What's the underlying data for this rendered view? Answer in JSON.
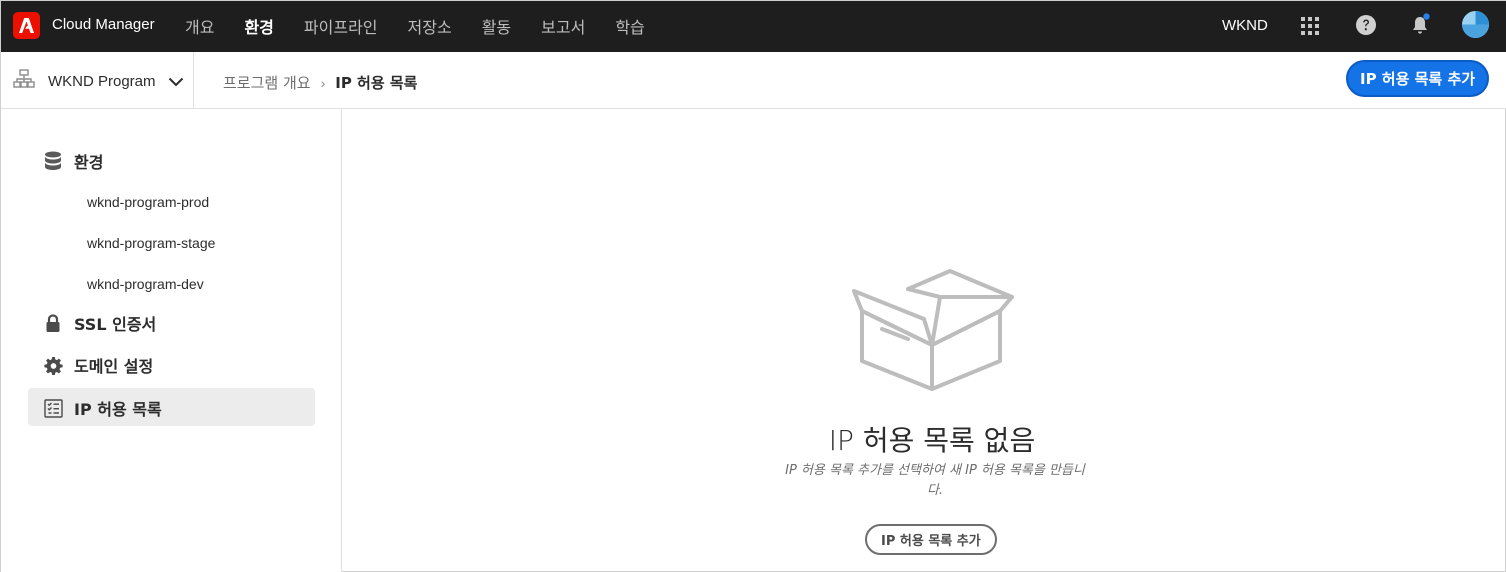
{
  "app": {
    "title": "Cloud Manager",
    "brand_color": "#eb1000",
    "logo_icon": "adobe-logo"
  },
  "nav": {
    "items": [
      {
        "label": "개요",
        "active": false
      },
      {
        "label": "환경",
        "active": true
      },
      {
        "label": "파이프라인",
        "active": false
      },
      {
        "label": "저장소",
        "active": false
      },
      {
        "label": "활동",
        "active": false
      },
      {
        "label": "보고서",
        "active": false
      },
      {
        "label": "학습",
        "active": false
      }
    ],
    "org": "WKND",
    "icons": [
      "apps-grid-icon",
      "help-icon",
      "notification-bell-icon",
      "avatar"
    ]
  },
  "subheader": {
    "program": "WKND Program",
    "breadcrumb": {
      "parent": "프로그램 개요",
      "separator": "›",
      "current": "IP 허용 목록"
    },
    "cta": "IP 허용 목록 추가",
    "accent": "#1473e6"
  },
  "sidebar": {
    "environments": {
      "label": "환경",
      "icon": "database-icon",
      "items": [
        "wknd-program-prod",
        "wknd-program-stage",
        "wknd-program-dev"
      ]
    },
    "ssl": {
      "label": "SSL 인증서",
      "icon": "lock-icon"
    },
    "domains": {
      "label": "도메인 설정",
      "icon": "gear-icon"
    },
    "allowlist": {
      "label": "IP 허용 목록",
      "icon": "checklist-icon",
      "active": true
    }
  },
  "empty_state": {
    "title": "IP 허용 목록 없음",
    "description": "IP 허용 목록 추가를 선택하여 새 IP 허용 목록을 만듭니다.",
    "button": "IP 허용 목록 추가",
    "illustration": "open-box-icon"
  }
}
